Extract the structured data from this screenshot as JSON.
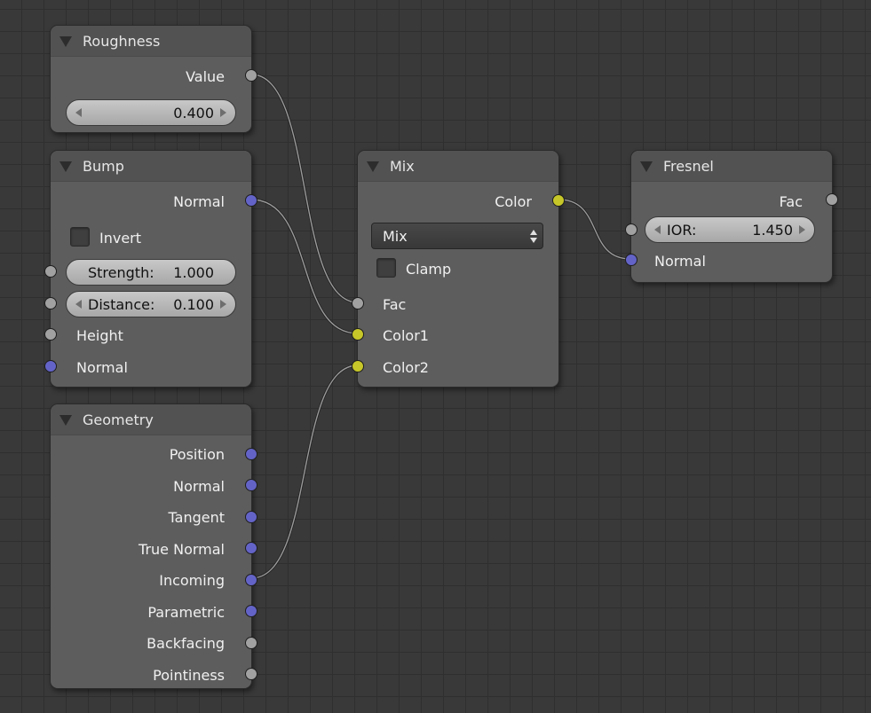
{
  "nodes": {
    "roughness": {
      "title": "Roughness",
      "output_value": "Value",
      "field_value": "0.400"
    },
    "bump": {
      "title": "Bump",
      "output_normal": "Normal",
      "invert_label": "Invert",
      "strength_label": "Strength:",
      "strength_value": "1.000",
      "distance_label": "Distance:",
      "distance_value": "0.100",
      "input_height": "Height",
      "input_normal": "Normal"
    },
    "geometry": {
      "title": "Geometry",
      "outputs": [
        "Position",
        "Normal",
        "Tangent",
        "True Normal",
        "Incoming",
        "Parametric",
        "Backfacing",
        "Pointiness"
      ]
    },
    "mix": {
      "title": "Mix",
      "output_color": "Color",
      "blend_mode": "Mix",
      "clamp_label": "Clamp",
      "input_fac": "Fac",
      "input_color1": "Color1",
      "input_color2": "Color2"
    },
    "fresnel": {
      "title": "Fresnel",
      "output_fac": "Fac",
      "ior_label": "IOR:",
      "ior_value": "1.450",
      "input_normal": "Normal"
    }
  },
  "colors": {
    "socket_float": "#a1a1a1",
    "socket_vector": "#6363c7",
    "socket_color": "#c7c729",
    "node_body": "#5d5d5d",
    "node_header": "#525252",
    "grid_background": "#393939"
  },
  "icons": {
    "collapse": "triangle-down-icon",
    "field_decrement": "arrow-left-icon",
    "field_increment": "arrow-right-icon",
    "dropdown": "updown-arrows-icon"
  }
}
